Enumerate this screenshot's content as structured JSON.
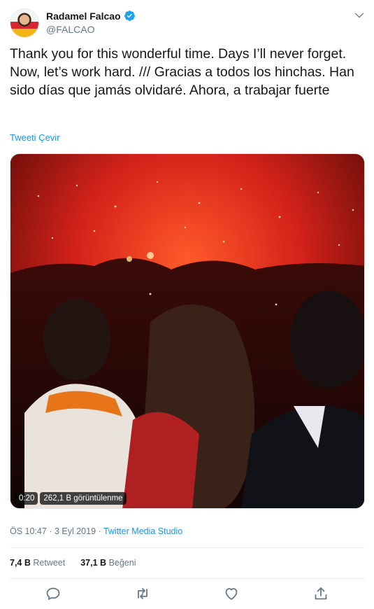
{
  "author": {
    "display_name": "Radamel Falcao",
    "handle": "@FALCAO",
    "verified_icon": "verified-badge-icon",
    "avatar": "avatar"
  },
  "tweet": {
    "text": "Thank you for this wonderful time. Days I’ll never forget. Now, let’s work hard. /// Gracias a todos los hinchas. Han sido días que jamás olvidaré. Ahora, a trabajar fuerte",
    "translate_label": "Tweeti Çevir"
  },
  "media": {
    "duration": "0:20",
    "views": "262,1 B görüntülenme"
  },
  "meta": {
    "time": "ÖS 10:47",
    "date": "3 Eyl 2019",
    "separator": "·",
    "source": "Twitter Media Studio"
  },
  "stats": {
    "retweets_count": "7,4 B",
    "retweets_label": "Retweet",
    "likes_count": "37,1 B",
    "likes_label": "Beğeni"
  },
  "actions": {
    "icons": [
      "reply-icon",
      "retweet-icon",
      "like-icon",
      "share-icon"
    ]
  },
  "colors": {
    "link": "#1b95e0",
    "secondary_text": "#657786",
    "divider": "#e6ecf0"
  }
}
